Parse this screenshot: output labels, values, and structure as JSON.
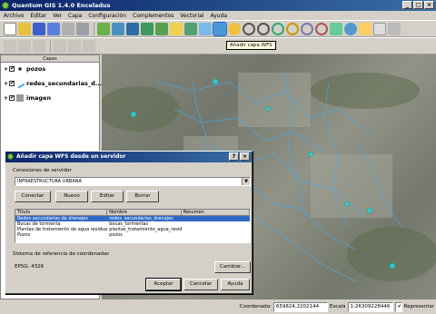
{
  "window": {
    "title": "Quantum GIS 1.4.0 Enceladus"
  },
  "menu": [
    "Archivo",
    "Editar",
    "Ver",
    "Capa",
    "Configuración",
    "Complementos",
    "Vectorial",
    "Ayuda"
  ],
  "tooltip": "Añadir capa WFS",
  "layers_panel": {
    "title": "Capas",
    "layers": [
      {
        "name": "pozos",
        "checked": "✔"
      },
      {
        "name": "redes_secundarias_d...",
        "checked": "✔"
      },
      {
        "name": "imagen",
        "checked": "✔"
      }
    ]
  },
  "status": {
    "coord_label": "Coordenada:",
    "coord_value": "659824,2202144",
    "scale_label": "Escala",
    "scale_value": "1:26309228446",
    "render_label": "Representar"
  },
  "dialog": {
    "title": "Añadir capa WFS desde un servidor",
    "connections_label": "Conexiones de servidor",
    "connection_selected": "INFRAESTRUCTURA URBANA",
    "buttons": {
      "connect": "Conectar",
      "new": "Nuevo",
      "edit": "Editar",
      "delete": "Borrar"
    },
    "columns": [
      "Título",
      "Nombre",
      "Resumen"
    ],
    "rows": [
      {
        "title": "Redes secundarias de drenajes",
        "name": "redes_secundarias_drenajes",
        "summary": ""
      },
      {
        "title": "Bocas de tormenta",
        "name": "bocas_tormentas",
        "summary": ""
      },
      {
        "title": "Plantas de tratamiento de agua residual",
        "name": "plantas_tratamiento_agua_residual",
        "summary": ""
      },
      {
        "title": "Pozos",
        "name": "pozos",
        "summary": ""
      }
    ],
    "crs_label": "Sistema de referencia de coordenadas",
    "crs_value": "EPSG: 4326",
    "change_button": "Cambiar...",
    "ok_button": "Aceptar",
    "cancel_button": "Cancelar",
    "help_button": "Ayuda"
  },
  "colors": {
    "title_bar": "#0a246a",
    "selection": "#316ac5",
    "network_lines": "#4aa8e8"
  }
}
